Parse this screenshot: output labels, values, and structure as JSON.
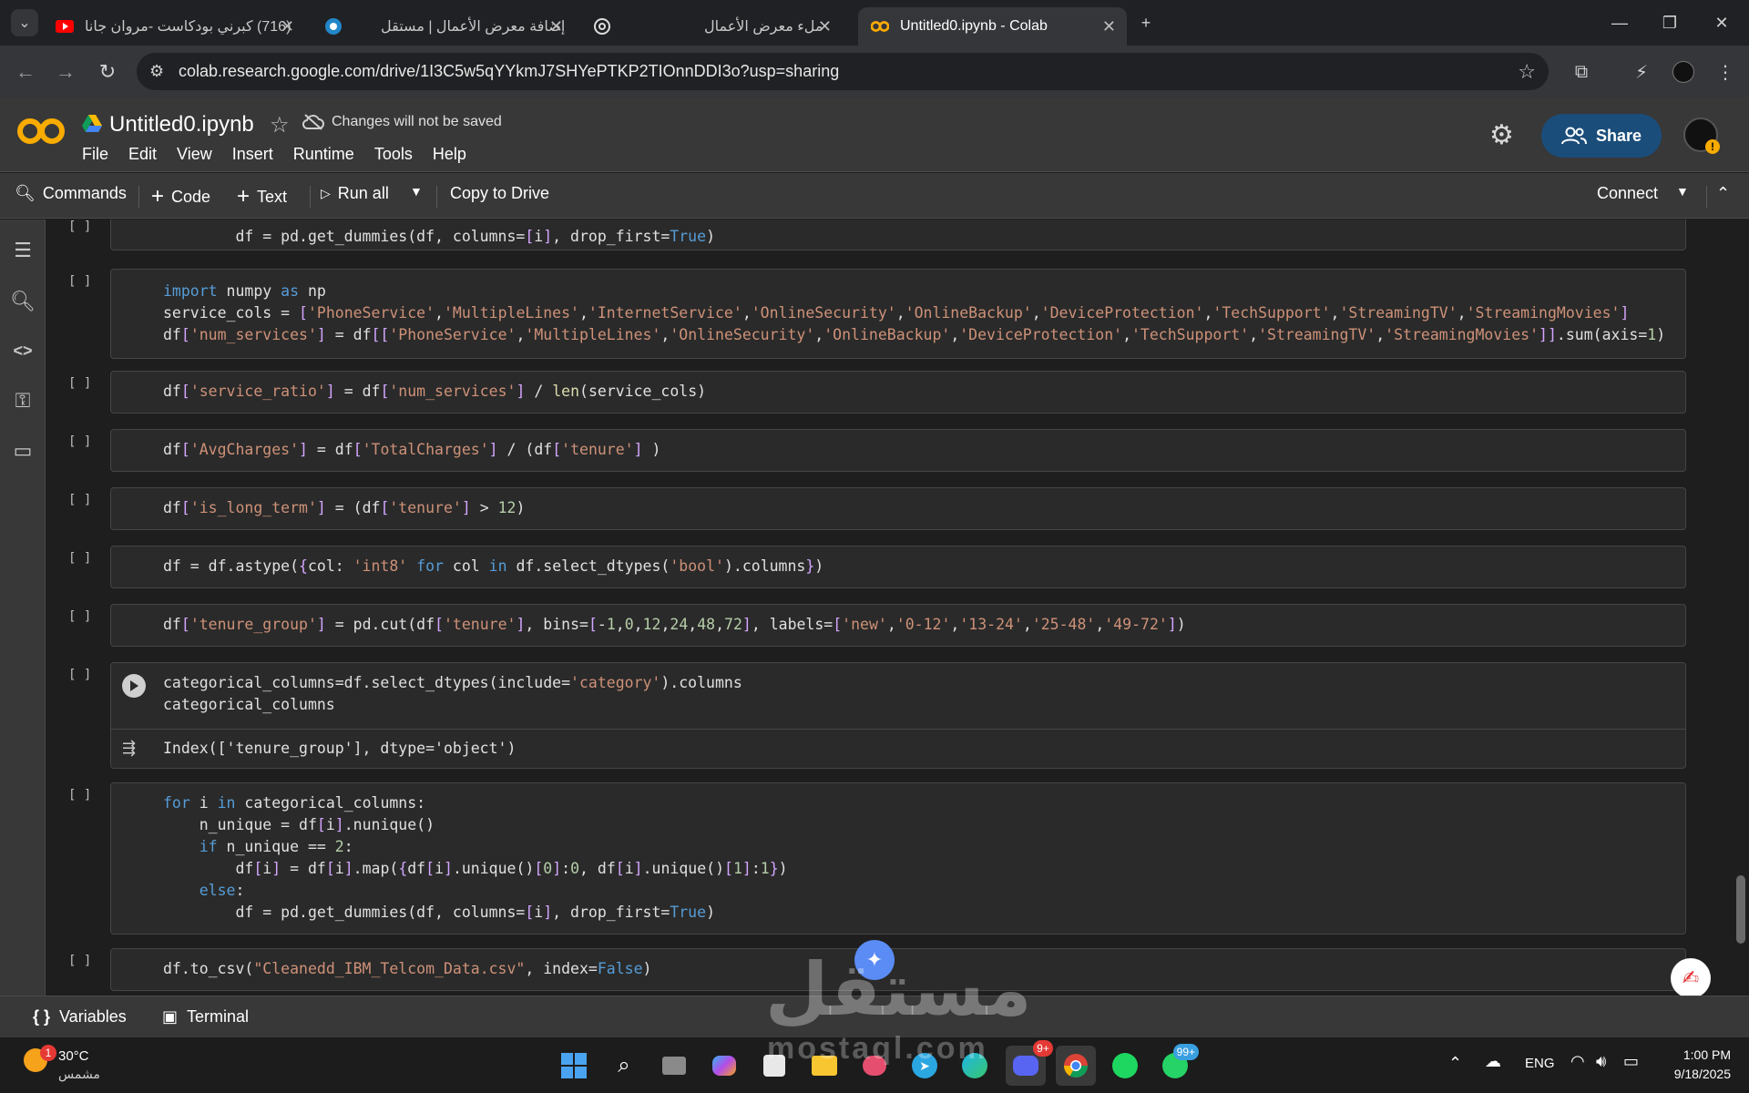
{
  "browser": {
    "tabs": [
      {
        "title": "(716) كبرني بودكاست -مروان جانا",
        "icon": "youtube-icon"
      },
      {
        "title": "إضافة معرض الأعمال | مستقل",
        "icon": "mostaql-icon"
      },
      {
        "title": "ملء معرض الأعمال",
        "icon": "chatgpt-icon"
      },
      {
        "title": "Untitled0.ipynb - Colab",
        "icon": "colab-icon"
      }
    ],
    "url": "colab.research.google.com/drive/1I3C5w5qYYkmJ7SHYePTKP2TIOnnDDI3o?usp=sharing"
  },
  "colab": {
    "title": "Untitled0.ipynb",
    "unsaved_notice": "Changes will not be saved",
    "menu": [
      "File",
      "Edit",
      "View",
      "Insert",
      "Runtime",
      "Tools",
      "Help"
    ],
    "share_label": "Share",
    "toolbar": {
      "commands": "Commands",
      "code": "Code",
      "text": "Text",
      "run_all": "Run all",
      "copy_to_drive": "Copy to Drive",
      "connect": "Connect"
    },
    "cell_bracket": "[ ]",
    "cells": [
      {
        "lines": [
          "        df = pd.get_dummies(df, columns=[i], drop_first=True)"
        ]
      },
      {
        "lines": [
          "import numpy as np",
          "service_cols = ['PhoneService','MultipleLines','InternetService','OnlineSecurity','OnlineBackup','DeviceProtection','TechSupport','StreamingTV','StreamingMovies']",
          "df['num_services'] = df[['PhoneService','MultipleLines','OnlineSecurity','OnlineBackup','DeviceProtection','TechSupport','StreamingTV','StreamingMovies']].sum(axis=1)"
        ]
      },
      {
        "lines": [
          "df['service_ratio'] = df['num_services'] / len(service_cols)"
        ]
      },
      {
        "lines": [
          "df['AvgCharges'] = df['TotalCharges'] / (df['tenure'] )"
        ]
      },
      {
        "lines": [
          "df['is_long_term'] = (df['tenure'] > 12)"
        ]
      },
      {
        "lines": [
          "df = df.astype({col: 'int8' for col in df.select_dtypes('bool').columns})"
        ]
      },
      {
        "lines": [
          "df['tenure_group'] = pd.cut(df['tenure'], bins=[-1,0,12,24,48,72], labels=['new','0-12','13-24','25-48','49-72'])"
        ]
      },
      {
        "lines": [
          "categorical_columns=df.select_dtypes(include='category').columns",
          "categorical_columns"
        ],
        "output": "Index(['tenure_group'], dtype='object')"
      },
      {
        "lines": [
          "for i in categorical_columns:",
          "    n_unique = df[i].nunique()",
          "    if n_unique == 2:",
          "        df[i] = df[i].map({df[i].unique()[0]:0, df[i].unique()[1]:1})",
          "    else:",
          "        df = pd.get_dummies(df, columns=[i], drop_first=True)"
        ]
      },
      {
        "lines": [
          "df.to_csv(\"Cleanedd_IBM_Telcom_Data.csv\", index=False)"
        ]
      }
    ],
    "bottom": {
      "variables": "Variables",
      "terminal": "Terminal"
    }
  },
  "watermark": {
    "text": "مستقل",
    "sub": "mostaql.com"
  },
  "taskbar": {
    "weather_temp": "30°C",
    "weather_desc": "مشمس",
    "weather_badge": "1",
    "discord_badge": "9+",
    "whatsapp_badge": "99+",
    "lang": "ENG",
    "time": "1:00 PM",
    "date": "9/18/2025"
  }
}
